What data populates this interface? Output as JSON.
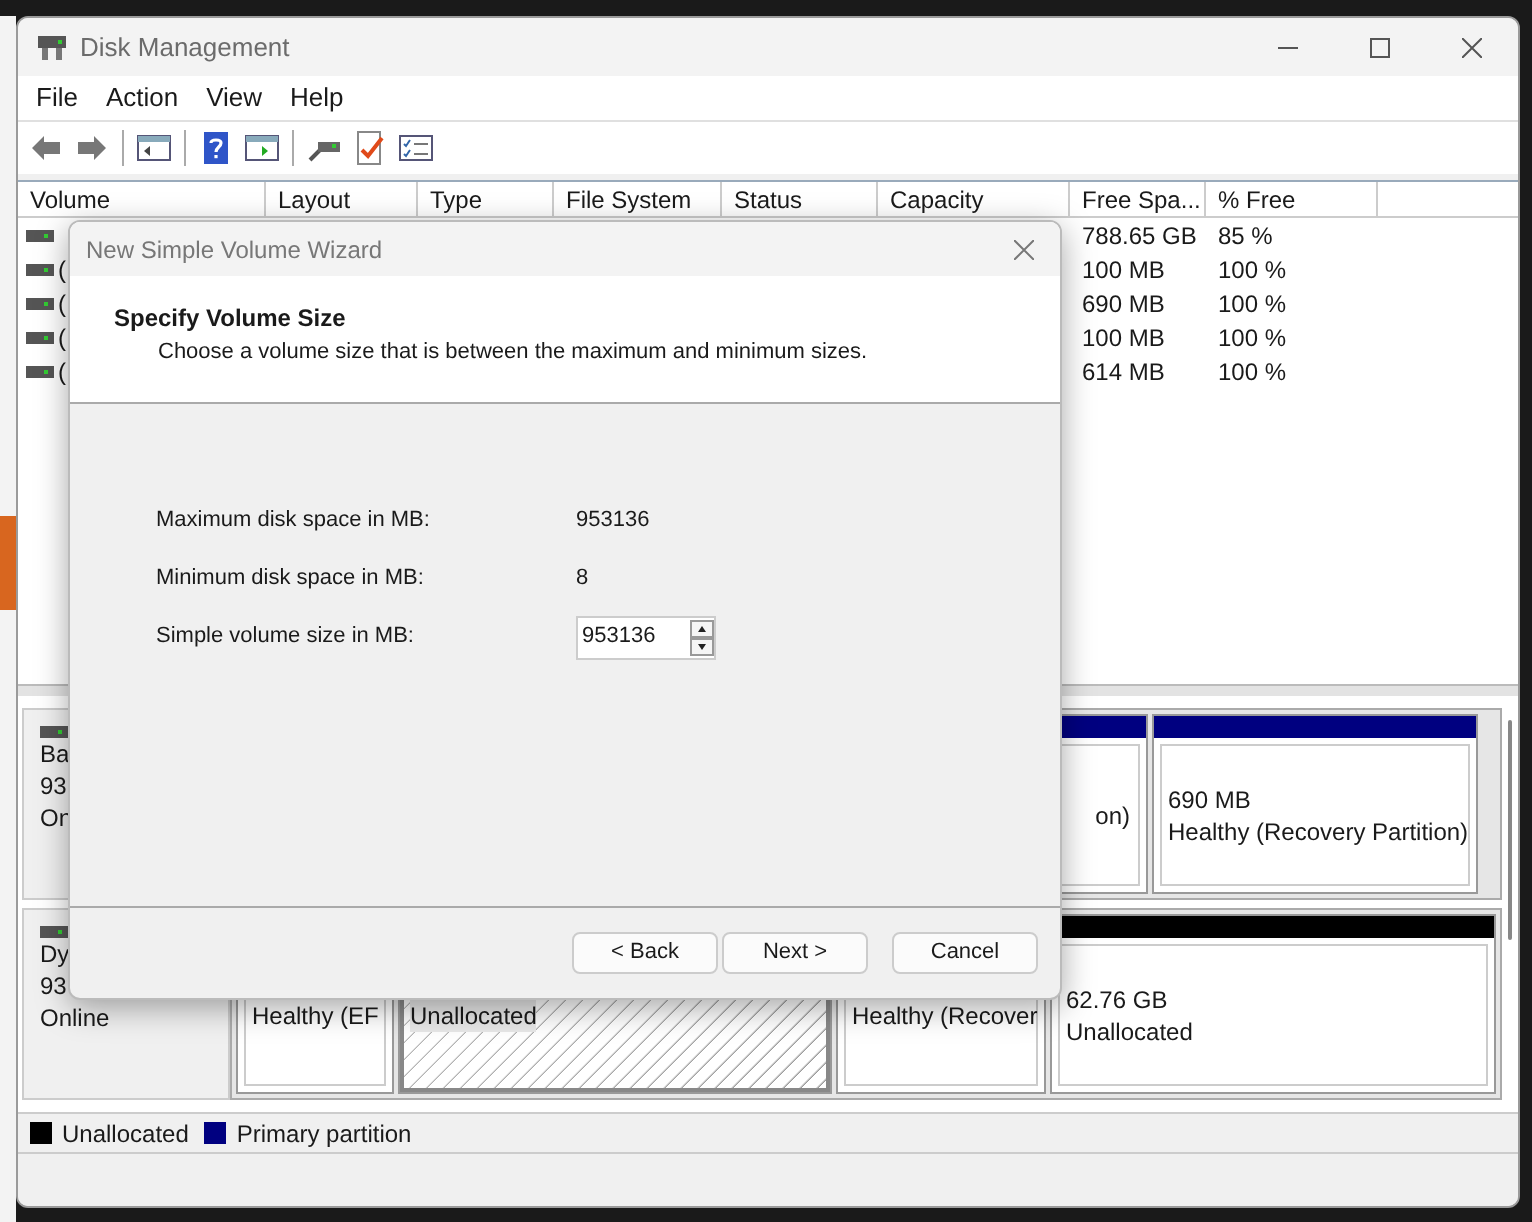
{
  "window": {
    "title": "Disk Management"
  },
  "menu": [
    "File",
    "Action",
    "View",
    "Help"
  ],
  "columns": [
    "Volume",
    "Layout",
    "Type",
    "File System",
    "Status",
    "Capacity",
    "Free Spa...",
    "% Free"
  ],
  "volumes": [
    {
      "free": "788.65 GB",
      "percent": "85 %"
    },
    {
      "volume": "(",
      "free": "100 MB",
      "percent": "100 %"
    },
    {
      "volume": "(",
      "free": "690 MB",
      "percent": "100 %"
    },
    {
      "volume": "(",
      "free": "100 MB",
      "percent": "100 %"
    },
    {
      "volume": "(",
      "free": "614 MB",
      "percent": "100 %"
    }
  ],
  "disks": [
    {
      "lines": [
        "Ba",
        "93",
        "On"
      ],
      "partitions": [
        {
          "kind": "primary",
          "selected": false,
          "lines": [
            "on)"
          ]
        },
        {
          "kind": "primary",
          "selected": false,
          "lines": [
            "690 MB",
            "Healthy (Recovery Partition)"
          ]
        }
      ]
    },
    {
      "lines": [
        "Dy",
        "93",
        "Online"
      ],
      "partitions": [
        {
          "selected": false,
          "lines": [
            "Healthy (EF"
          ]
        },
        {
          "selected": true,
          "lines": [
            "Unallocated"
          ]
        },
        {
          "selected": false,
          "lines": [
            "Healthy (Recover"
          ]
        },
        {
          "kind": "unallocated",
          "selected": false,
          "lines": [
            "62.76 GB",
            "Unallocated"
          ]
        }
      ]
    }
  ],
  "legend": [
    {
      "label": "Unallocated",
      "color": "#000000"
    },
    {
      "label": "Primary partition",
      "color": "#000080"
    }
  ],
  "dialog": {
    "title": "New Simple Volume Wizard",
    "heading": "Specify Volume Size",
    "subheading": "Choose a volume size that is between the maximum and minimum sizes.",
    "fields": [
      {
        "kind": "text",
        "label": "Maximum disk space in MB:",
        "value": "953136"
      },
      {
        "kind": "text",
        "label": "Minimum disk space in MB:",
        "value": "8"
      },
      {
        "kind": "spin",
        "label": "Simple volume size in MB:",
        "value": "953136"
      }
    ],
    "buttons": [
      "< Back",
      "Next >",
      "Cancel"
    ]
  }
}
